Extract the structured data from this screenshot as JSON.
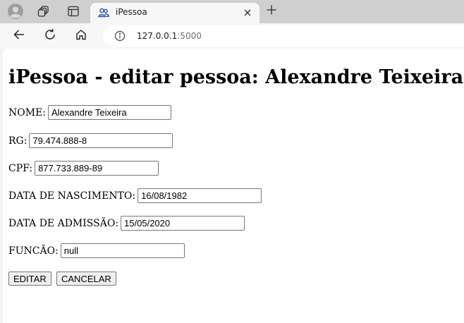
{
  "browser": {
    "tab_title": "iPessoa",
    "url_host": "127.0.0.1",
    "url_port": ":5000",
    "icons": {
      "profile": "profile-icon",
      "workspaces": "workspaces-icon",
      "tab_actions": "tab-actions-icon",
      "tab_favicon": "people-icon",
      "close": "close-icon",
      "new_tab": "plus-icon",
      "back": "back-arrow-icon",
      "refresh": "refresh-icon",
      "home": "home-icon",
      "site_info": "info-icon"
    }
  },
  "page": {
    "heading": "iPessoa - editar pessoa: Alexandre Teixeira",
    "fields": [
      {
        "label": "NOME:",
        "value": "Alexandre Teixeira"
      },
      {
        "label": "RG:",
        "value": "79.474.888-8"
      },
      {
        "label": "CPF:",
        "value": "877.733.889-89"
      },
      {
        "label": "DATA DE NASCIMENTO:",
        "value": "16/08/1982"
      },
      {
        "label": "DATA DE ADMISSÃO:",
        "value": "15/05/2020"
      },
      {
        "label": "FUNCÃO:",
        "value": "null"
      }
    ],
    "buttons": {
      "edit": "EDITAR",
      "cancel": "CANCELAR"
    }
  },
  "colors": {
    "tabstrip": "#cfcfcf",
    "toolbar": "#f7f7f7",
    "favicon_blue": "#1e4fa8"
  }
}
